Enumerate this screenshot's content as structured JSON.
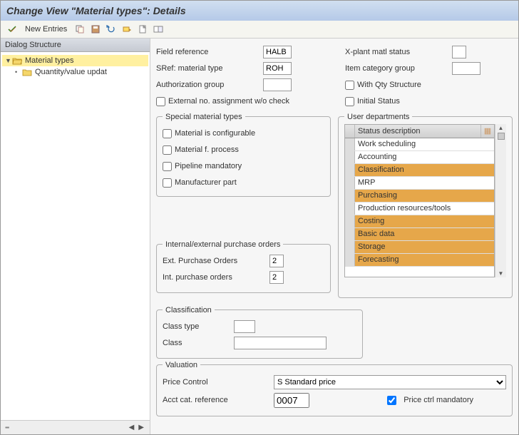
{
  "title": "Change View \"Material types\": Details",
  "toolbar": {
    "new_entries": "New Entries"
  },
  "sidebar": {
    "header": "Dialog Structure",
    "items": [
      {
        "label": "Material types",
        "selected": true,
        "level": 0,
        "open": true
      },
      {
        "label": "Quantity/value updat",
        "selected": false,
        "level": 1,
        "open": false
      }
    ]
  },
  "fields_left": {
    "field_ref_label": "Field reference",
    "field_ref_value": "HALB",
    "sref_label": "SRef: material type",
    "sref_value": "ROH",
    "auth_label": "Authorization group",
    "auth_value": "",
    "extno_label": "External no. assignment w/o check",
    "extno_checked": false
  },
  "fields_right": {
    "xplant_label": "X-plant matl status",
    "xplant_value": "",
    "itemcat_label": "Item category group",
    "itemcat_value": "",
    "withqty_label": "With Qty Structure",
    "withqty_checked": false,
    "initstat_label": "Initial Status",
    "initstat_checked": false
  },
  "special": {
    "title": "Special material types",
    "mat_config": "Material is configurable",
    "mat_process": "Material f. process",
    "pipeline": "Pipeline mandatory",
    "manufacturer": "Manufacturer part"
  },
  "user_depts": {
    "title": "User departments",
    "col_header": "Status description",
    "rows": [
      {
        "label": "Work scheduling",
        "selected": false
      },
      {
        "label": "Accounting",
        "selected": false
      },
      {
        "label": "Classification",
        "selected": true
      },
      {
        "label": "MRP",
        "selected": false
      },
      {
        "label": "Purchasing",
        "selected": true
      },
      {
        "label": "Production resources/tools",
        "selected": false
      },
      {
        "label": "Costing",
        "selected": true
      },
      {
        "label": "Basic data",
        "selected": true
      },
      {
        "label": "Storage",
        "selected": true
      },
      {
        "label": "Forecasting",
        "selected": true
      }
    ]
  },
  "purchase": {
    "title": "Internal/external purchase orders",
    "ext_label": "Ext. Purchase Orders",
    "ext_value": "2",
    "int_label": "Int. purchase orders",
    "int_value": "2"
  },
  "classification": {
    "title": "Classification",
    "classtype_label": "Class type",
    "classtype_value": "",
    "class_label": "Class",
    "class_value": ""
  },
  "valuation": {
    "title": "Valuation",
    "price_control_label": "Price Control",
    "price_control_value": "S Standard price",
    "acct_label": "Acct cat. reference",
    "acct_value": "0007",
    "pmandatory_label": "Price ctrl mandatory",
    "pmandatory_checked": true
  }
}
